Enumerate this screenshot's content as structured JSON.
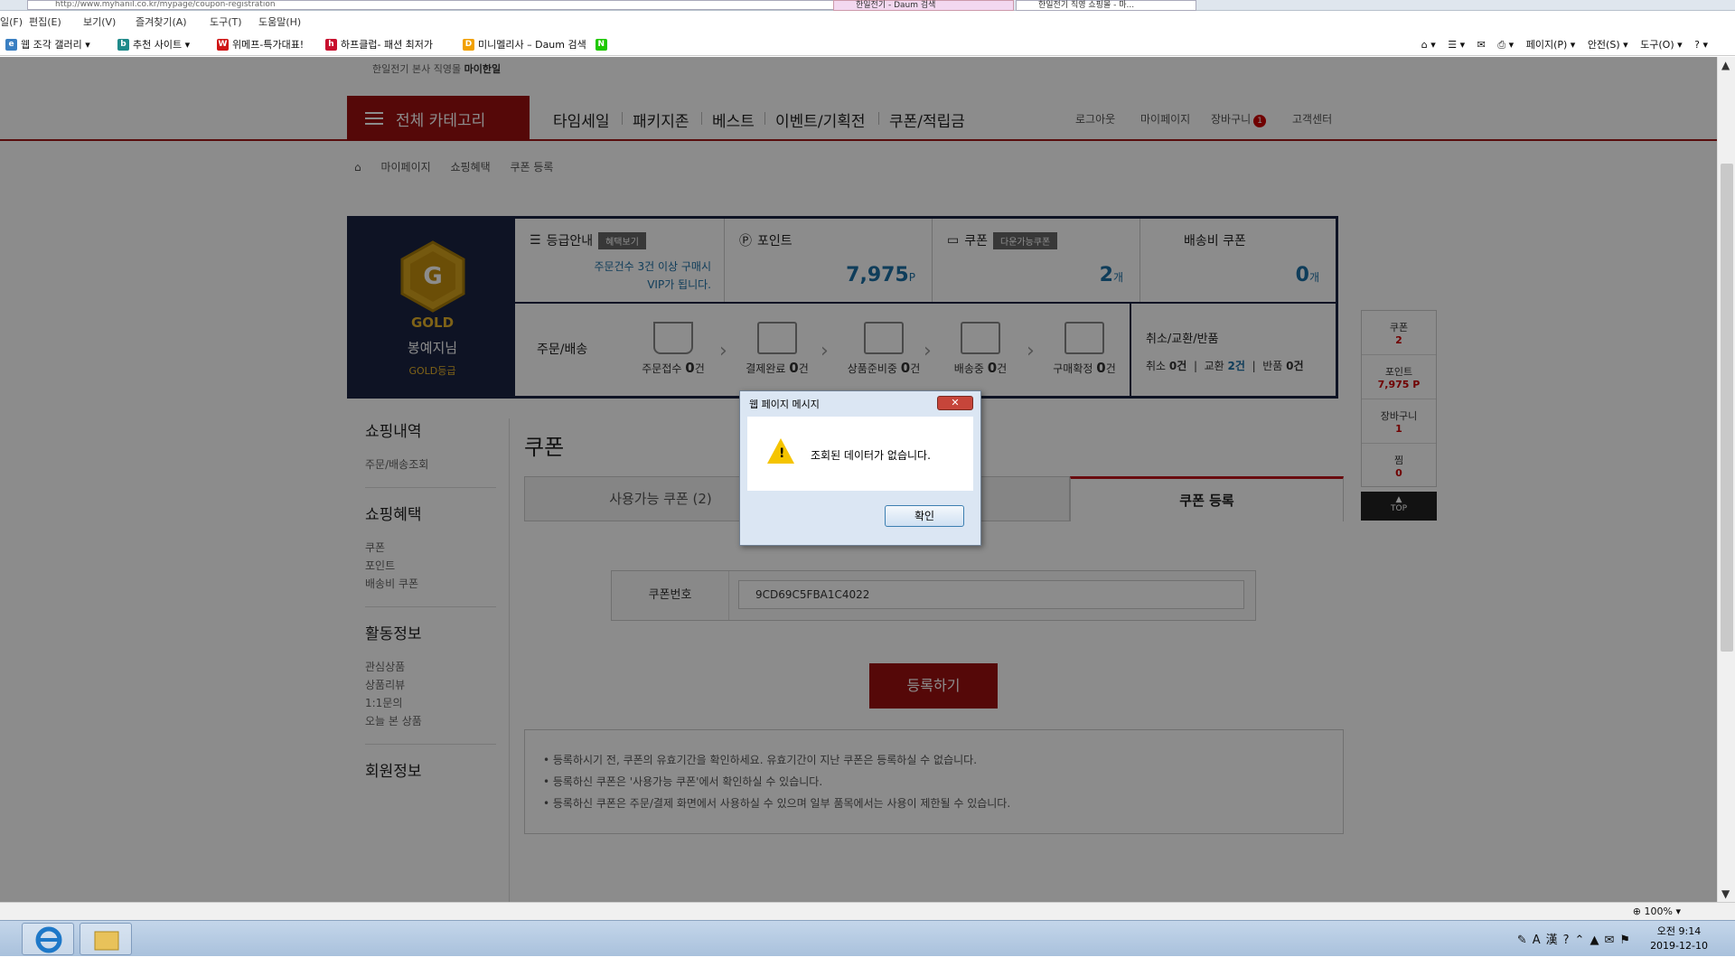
{
  "browser": {
    "url": "http://www.myhanil.co.kr/mypage/coupon-registration",
    "tabs": [
      "한일전기 - Daum 검색",
      "한일전기 직영 쇼핑몰 - 마..."
    ],
    "menu": [
      "일(F)",
      "편집(E)",
      "보기(V)",
      "즐겨찾기(A)",
      "도구(T)",
      "도움말(H)"
    ],
    "favorites": [
      {
        "label": "웹 조각 갤러리 ▾",
        "icon": "web-slice-icon"
      },
      {
        "label": "추천 사이트 ▾",
        "icon": "bing-icon"
      },
      {
        "label": "위메프-특가대표!",
        "icon": "wemakeprice-icon"
      },
      {
        "label": "하프클럽- 패션 최저가",
        "icon": "halfclub-icon"
      },
      {
        "label": "미니멜리사 – Daum 검색",
        "icon": "daum-icon"
      }
    ],
    "tools": [
      "페이지(P) ▾",
      "안전(S) ▾",
      "도구(O) ▾"
    ],
    "zoom": "100%"
  },
  "site": {
    "tagline": "한일전기 본사 직영몰",
    "tagline_brand": "마이한일",
    "all_category": "전체 카테고리",
    "nav": [
      "타임세일",
      "패키지존",
      "베스트",
      "이벤트/기획전",
      "쿠폰/적립금"
    ],
    "util": [
      "로그아웃",
      "마이페이지",
      "장바구니",
      "고객센터"
    ],
    "cart_count": "1",
    "breadcrumb": [
      "마이페이지",
      "쇼핑혜택",
      "쿠폰 등록"
    ]
  },
  "grade": {
    "letter": "G",
    "level": "GOLD",
    "user": "봉예지님",
    "grade_label": "GOLD등급",
    "info_title": "등급안내",
    "info_tag": "혜택보기",
    "info_line1": "주문건수 3건 이상 구매시",
    "info_line2": "VIP가 됩니다.",
    "point_title": "포인트",
    "point_value": "7,975",
    "point_unit": "P",
    "coupon_title": "쿠폰",
    "coupon_tag": "다운가능쿠폰",
    "coupon_value": "2",
    "coupon_unit": "개",
    "ship_title": "배송비 쿠폰",
    "ship_value": "0",
    "ship_unit": "개",
    "order_label": "주문/배송",
    "steps": [
      {
        "label": "주문접수",
        "count": "0",
        "unit": "건",
        "icon": "cart-icon"
      },
      {
        "label": "결제완료",
        "count": "0",
        "unit": "건",
        "icon": "card-icon"
      },
      {
        "label": "상품준비중",
        "count": "0",
        "unit": "건",
        "icon": "box-icon"
      },
      {
        "label": "배송중",
        "count": "0",
        "unit": "건",
        "icon": "truck-icon"
      },
      {
        "label": "구매확정",
        "count": "0",
        "unit": "건",
        "icon": "check-box-icon"
      }
    ],
    "cancel_title": "취소/교환/반품",
    "cancel_items": [
      "취소",
      "0건",
      "교환",
      "2건",
      "반품",
      "0건"
    ]
  },
  "sidebar": {
    "sections": [
      {
        "title": "쇼핑내역",
        "items": [
          "주문/배송조회"
        ]
      },
      {
        "title": "쇼핑혜택",
        "items": [
          "쿠폰",
          "포인트",
          "배송비 쿠폰"
        ]
      },
      {
        "title": "활동정보",
        "items": [
          "관심상품",
          "상품리뷰",
          "1:1문의",
          "오늘 본 상품"
        ]
      },
      {
        "title": "회원정보",
        "items": []
      }
    ]
  },
  "main": {
    "title": "쿠폰",
    "tabs": [
      "사용가능 쿠폰 (2)",
      "",
      "쿠폰 등록"
    ],
    "coupon_label": "쿠폰번호",
    "coupon_value": "9CD69C5FBA1C4022",
    "register_button": "등록하기",
    "notices": [
      "•  등록하시기 전, 쿠폰의 유효기간을 확인하세요. 유효기간이 지난 쿠폰은 등록하실 수 없습니다.",
      "•  등록하신 쿠폰은 '사용가능 쿠폰'에서 확인하실 수 있습니다.",
      "•  등록하신 쿠폰은 주문/결제 화면에서 사용하실 수 있으며 일부 품목에서는 사용이 제한될 수 있습니다."
    ]
  },
  "quick": {
    "items": [
      {
        "label": "쿠폰",
        "value": "2"
      },
      {
        "label": "포인트",
        "value": "7,975 P"
      },
      {
        "label": "장바구니",
        "value": "1"
      },
      {
        "label": "찜",
        "value": "0"
      }
    ],
    "top": "TOP"
  },
  "dialog": {
    "title": "웹 페이지 메시지",
    "message": "조회된 데이터가 없습니다.",
    "ok": "확인"
  },
  "taskbar": {
    "time": "오전 9:14",
    "date": "2019-12-10"
  }
}
